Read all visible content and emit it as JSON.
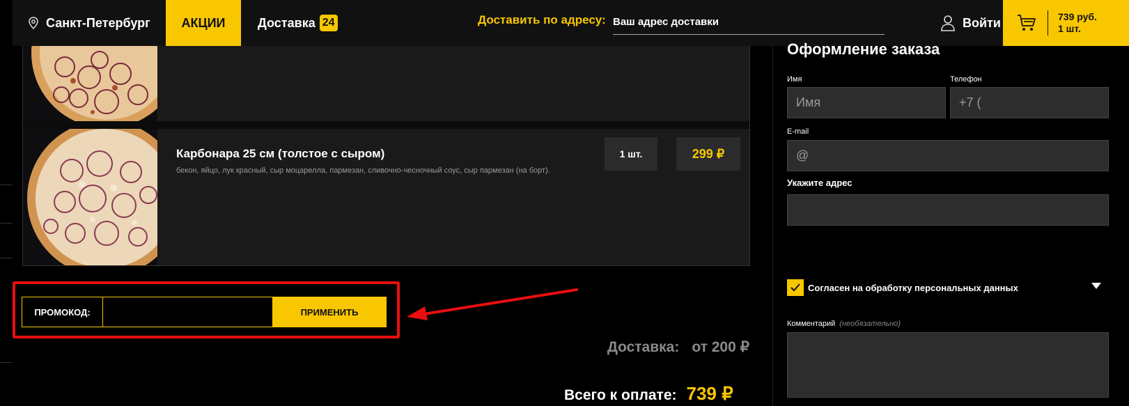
{
  "header": {
    "city": "Санкт-Петербург",
    "promo_tab": "АКЦИИ",
    "delivery_label": "Доставка",
    "delivery_badge": "24",
    "address_label": "Доставить по адресу:",
    "address_placeholder": "Ваш адрес доставки",
    "login_label": "Войти",
    "cart_sum": "739 руб.",
    "cart_count": "1 шт."
  },
  "items": [
    {
      "name": "Карбонара 25 см (толстое с сыром)",
      "description": "бекон, яйцо, лук красный, сыр моцарелла, пармезан, сливочно-чесночный соус, сыр пармезан (на борт).",
      "qty": "1 шт.",
      "price": "299 ₽"
    }
  ],
  "promo": {
    "label": "ПРОМОКОД:",
    "input_value": "",
    "apply_label": "ПРИМЕНИТЬ"
  },
  "totals": {
    "delivery_label": "Доставка:",
    "delivery_value": "от 200 ₽",
    "total_label": "Всего к оплате:",
    "total_value": "739 ₽"
  },
  "order_form": {
    "title": "Оформление заказа",
    "name_label": "Имя",
    "name_placeholder": "Имя",
    "phone_label": "Телефон",
    "phone_placeholder": "+7 (",
    "email_label": "E-mail",
    "email_placeholder": "@",
    "address_title": "Укажите адрес",
    "consent_label": "Согласен на обработку персональных данных",
    "consent_checked": true,
    "comment_label": "Комментарий",
    "comment_optional": "(необязательно)"
  },
  "colors": {
    "accent": "#f9c700",
    "highlight": "#e80f0f",
    "background": "#000000",
    "header": "#111111"
  }
}
